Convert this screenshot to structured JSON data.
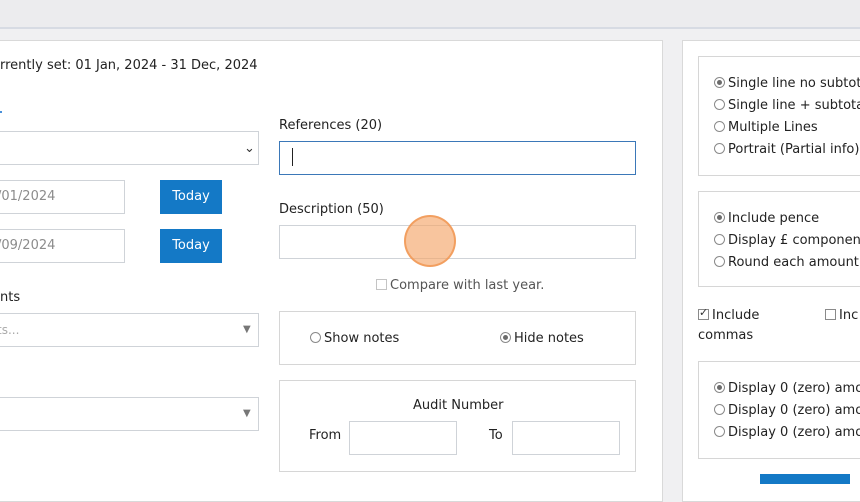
{
  "period_text": "rrently set: 01 Jan, 2024 - 31 Dec, 2024",
  "date_from": "/01/2024",
  "date_to": "/09/2024",
  "today_label": "Today",
  "accounts_label": "nts",
  "accounts_placeholder": "ts...",
  "references_label": "References (20)",
  "description_label": "Description (50)",
  "compare_label": "Compare with last year.",
  "show_notes_label": "Show notes",
  "hide_notes_label": "Hide notes",
  "audit_title": "Audit Number",
  "audit_from_label": "From",
  "audit_to_label": "To",
  "layout_options": [
    "Single line no subtota",
    "Single line + subtotal",
    "Multiple Lines",
    "Portrait (Partial info)"
  ],
  "pence_options": [
    "Include pence",
    "Display £ componen",
    "Round each amount"
  ],
  "include_commas_label": "Include",
  "include_commas_label2": "commas",
  "include_other_label": "Inc",
  "zero_options": [
    "Display 0 (zero) amo",
    "Display 0 (zero) amo",
    "Display 0 (zero) amo"
  ],
  "colors": {
    "accent": "#1479c6",
    "topbar": "#ececee",
    "border": "#d9d9d9"
  }
}
